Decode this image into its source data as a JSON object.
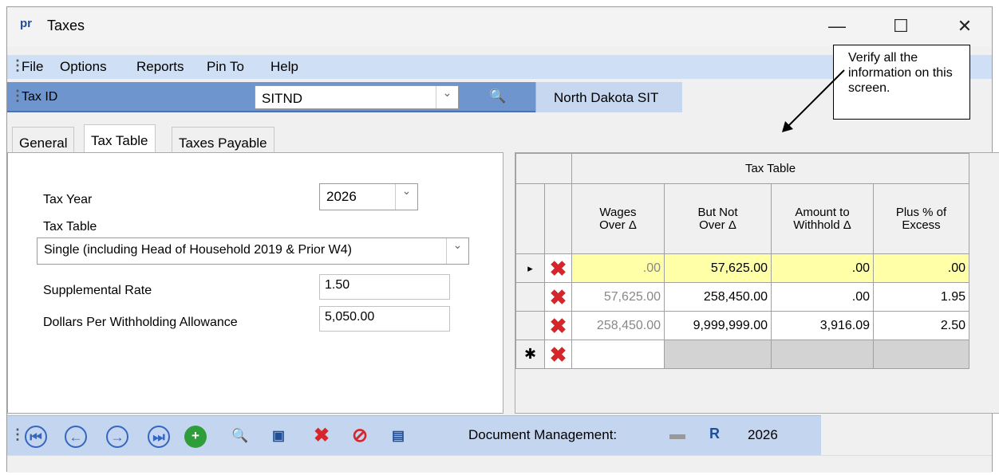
{
  "window": {
    "app_icon": "pr",
    "title": "Taxes",
    "minimize": "—",
    "maximize": "☐",
    "close": "✕"
  },
  "menu": {
    "items": [
      "File",
      "Options",
      "Reports",
      "Pin To",
      "Help"
    ]
  },
  "taxbar": {
    "label": "Tax ID",
    "value": "SITND",
    "tax_name": "North Dakota SIT"
  },
  "tabs": [
    "General",
    "Tax Table",
    "Taxes Payable"
  ],
  "form": {
    "tax_year_label": "Tax Year",
    "tax_year_value": "2026",
    "tax_table_label": "Tax Table",
    "tax_table_value": "Single (including Head of Household 2019 & Prior W4)",
    "supplemental_rate_label": "Supplemental Rate",
    "supplemental_rate_value": "1.50",
    "allowance_label": "Dollars Per Withholding Allowance",
    "allowance_value": "5,050.00"
  },
  "table": {
    "title": "Tax Table",
    "headers": [
      "Wages\nOver",
      "But Not\nOver",
      "Amount to\nWithhold",
      "Plus % of\nExcess"
    ],
    "sort_glyph": "Δ",
    "rows": [
      [
        "..00",
        "57,625.00",
        ".00",
        ".00"
      ],
      [
        "57,625.00",
        "258,450.00",
        ".00",
        "1.95"
      ],
      [
        "258,450.00",
        "9,999,999.00",
        "3,916.09",
        "2.50"
      ]
    ],
    "current_row_glyph": "▸",
    "new_row_glyph": "✱",
    "delete_glyph": "✖"
  },
  "toolbar": {
    "doc_label": "Document Management:",
    "year": "2026"
  },
  "callout": {
    "text": "Verify all the information on this screen."
  },
  "colors": {
    "menubar": "#cfdff5",
    "taxbar": "#6f95cf",
    "yellow": "#ffffa8",
    "delete": "#d6262b"
  }
}
